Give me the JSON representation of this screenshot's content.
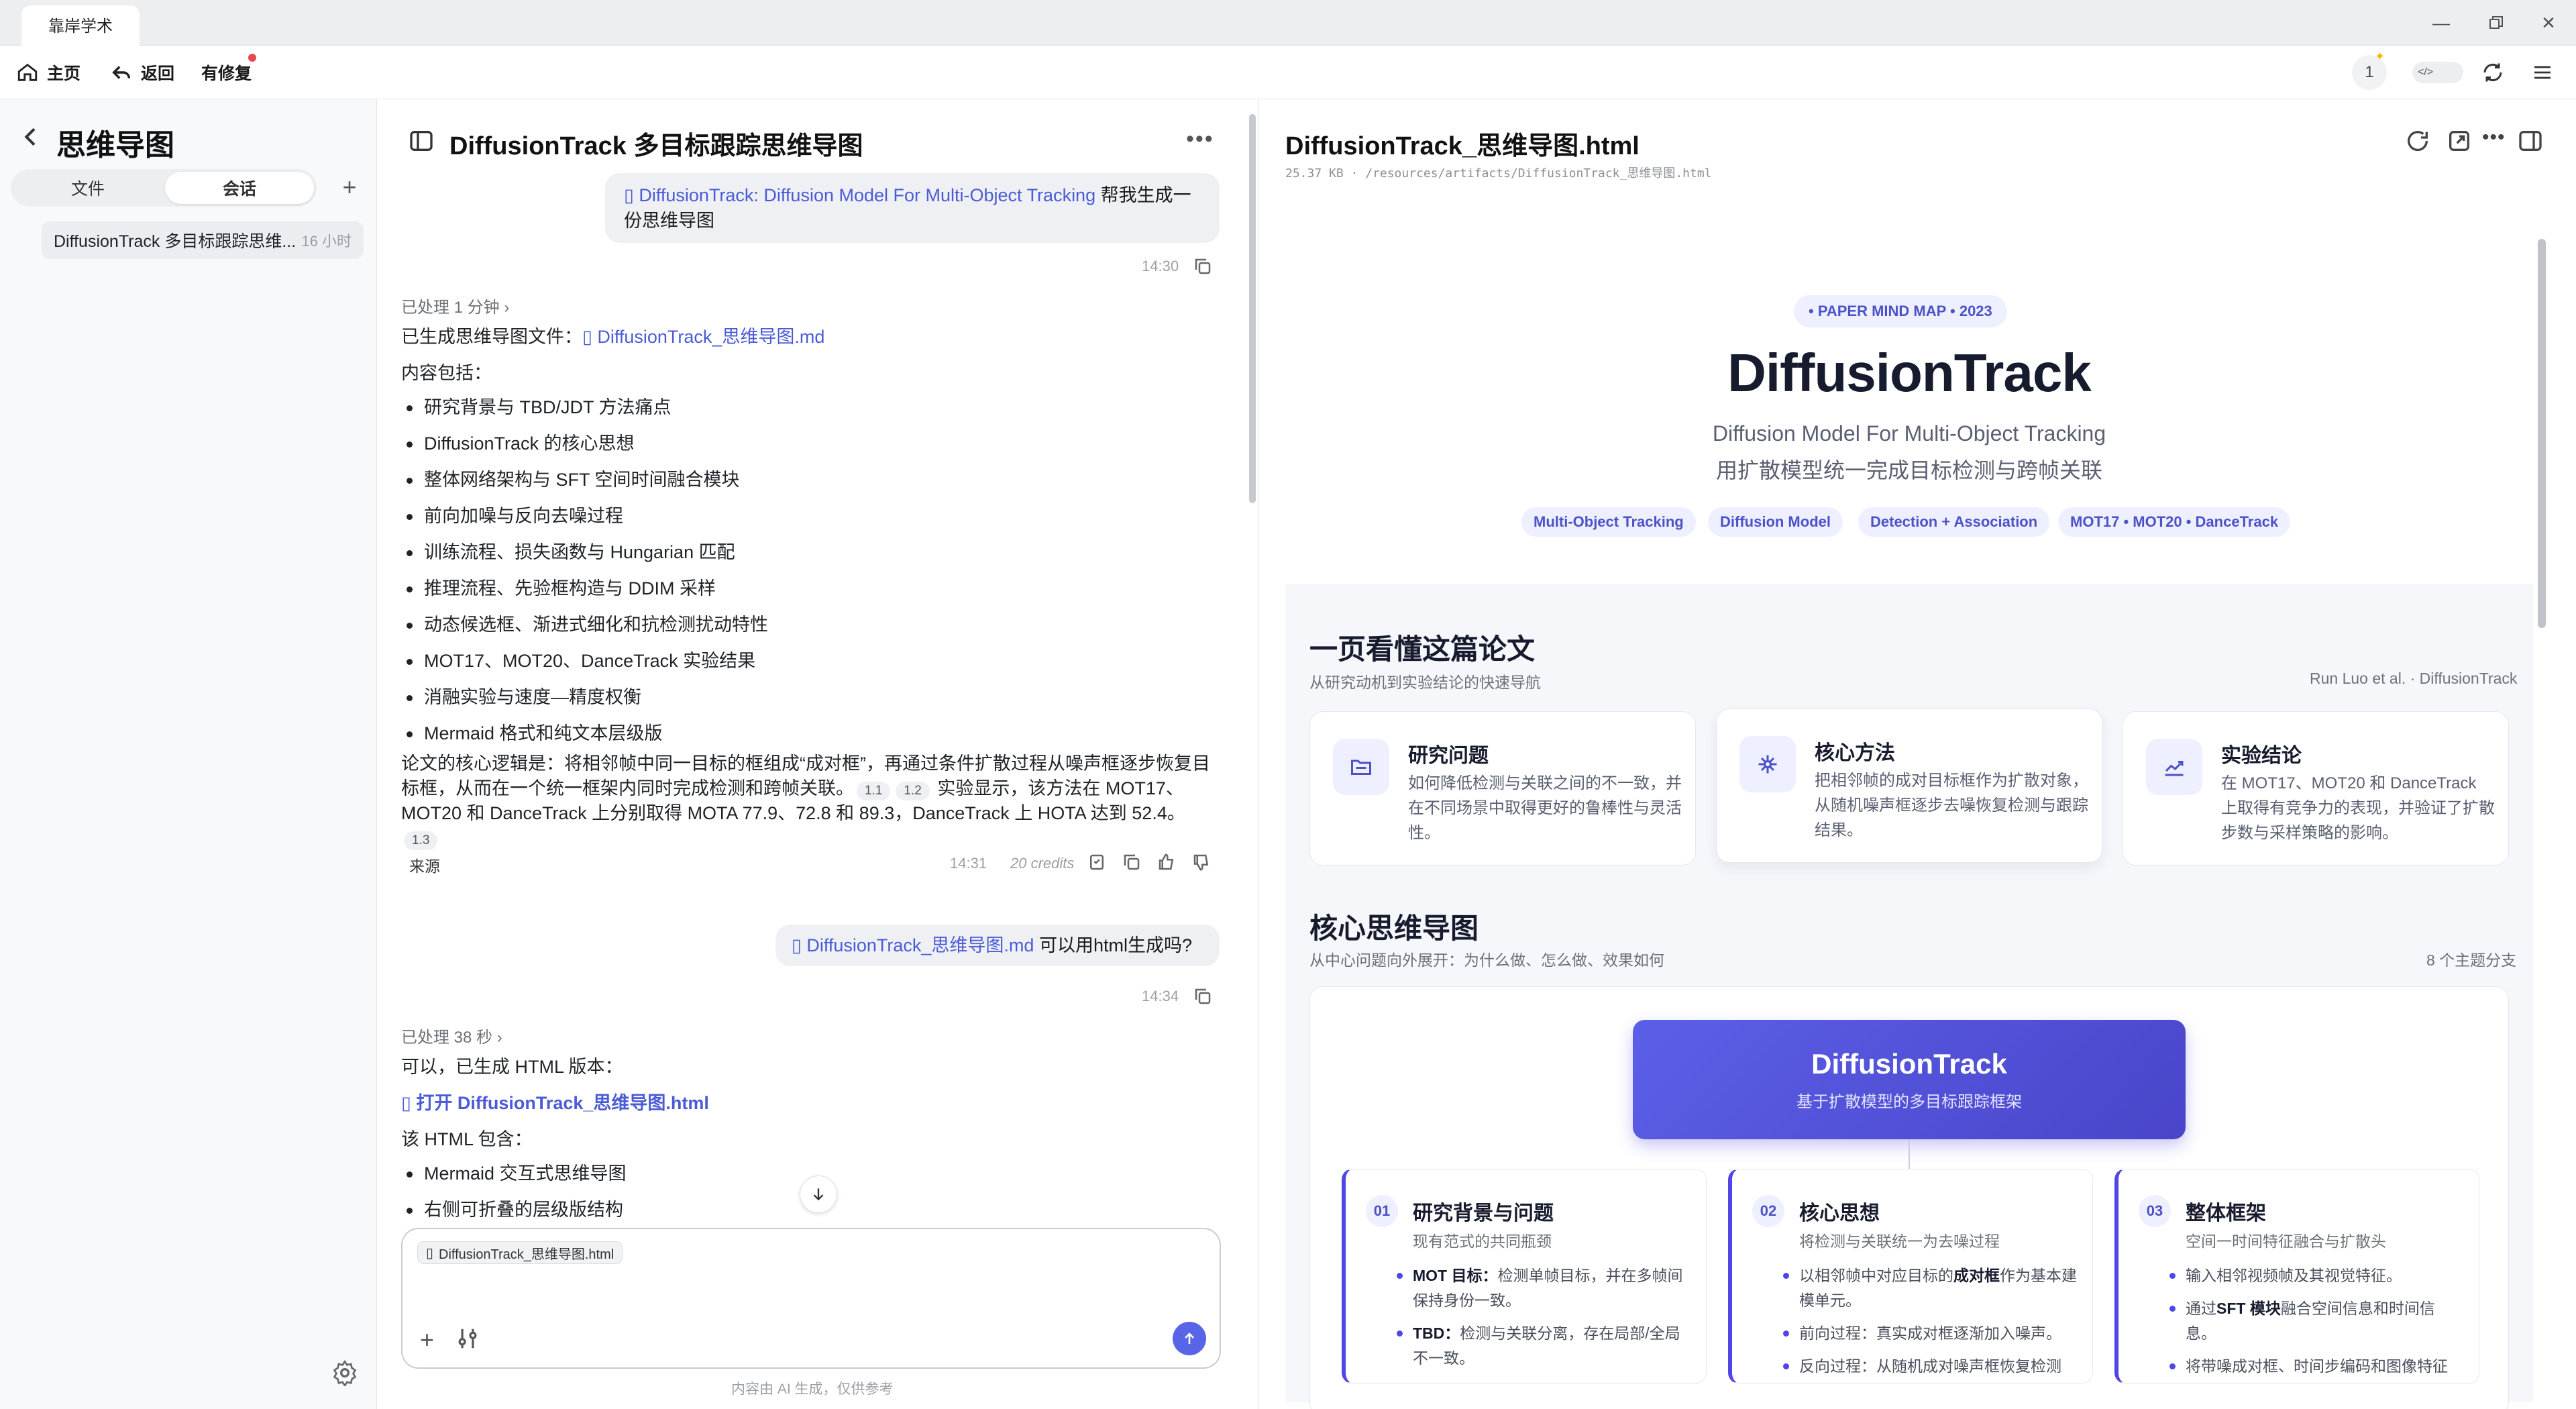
{
  "app": {
    "tab_title": "靠岸学术",
    "nav": {
      "home": "主页",
      "back": "返回",
      "update": "有修复"
    },
    "user_badge": "1"
  },
  "sidebar": {
    "title": "思维导图",
    "segments": [
      "文件",
      "会话"
    ],
    "items": [
      {
        "label": "DiffusionTrack 多目标跟踪思维...",
        "ago": "16 小时"
      }
    ]
  },
  "chat": {
    "title": "DiffusionTrack 多目标跟踪思维导图",
    "messages": {
      "user1": {
        "link": "DiffusionTrack: Diffusion Model For Multi-Object Tracking",
        "text": " 帮我生成一份思维导图",
        "time": "14:30"
      },
      "ai1": {
        "processed": "已处理 1 分钟",
        "file_prefix": "已生成思维导图文件：",
        "file_link": "DiffusionTrack_思维导图.md",
        "content_label": "内容包括：",
        "bullets": [
          "研究背景与 TBD/JDT 方法痛点",
          "DiffusionTrack 的核心思想",
          "整体网络架构与 SFT 空间时间融合模块",
          "前向加噪与反向去噪过程",
          "训练流程、损失函数与 Hungarian 匹配",
          "推理流程、先验框构造与 DDIM 采样",
          "动态候选框、渐进式细化和抗检测扰动特性",
          "MOT17、MOT20、DanceTrack 实验结果",
          "消融实验与速度—精度权衡",
          "Mermaid 格式和纯文本层级版"
        ],
        "summary_a": "论文的核心逻辑是：将相邻帧中同一目标的框组成“成对框”，再通过条件扩散过程从噪声框逐步恢复目标框，从而在一个统一框架内同时完成检测和跨帧关联。",
        "cite_1": "1.1",
        "cite_2": "1.2",
        "summary_b": " 实验显示，该方法在 MOT17、MOT20 和 DanceTrack 上分别取得 MOTA 77.9、72.8 和 89.3，DanceTrack 上 HOTA 达到 52.4。",
        "cite_3": "1.3",
        "source": "来源",
        "time": "14:31",
        "credits": "20 credits"
      },
      "user2": {
        "link": "DiffusionTrack_思维导图.md",
        "text": " 可以用html生成吗?",
        "time": "14:34"
      },
      "ai2": {
        "processed": "已处理 38 秒",
        "intro": "可以，已生成 HTML 版本：",
        "link": "打开 DiffusionTrack_思维导图.html",
        "includes": "该 HTML 包含：",
        "bullets": [
          "Mermaid 交互式思维导图",
          "右侧可折叠的层级版结构"
        ]
      }
    },
    "composer": {
      "attachment": "DiffusionTrack_思维导图.html"
    },
    "disclaimer": "内容由 AI 生成，仅供参考"
  },
  "preview": {
    "title": "DiffusionTrack_思维导图.html",
    "meta": "25.37 KB · /resources/artifacts/DiffusionTrack_思维导图.html",
    "hero": {
      "kicker": "• PAPER MIND MAP • 2023",
      "title": "DiffusionTrack",
      "subtitle_en": "Diffusion Model For Multi-Object Tracking",
      "subtitle_zh": "用扩散模型统一完成目标检测与跨帧关联",
      "tags": [
        "Multi-Object Tracking",
        "Diffusion Model",
        "Detection + Association",
        "MOT17 • MOT20 • DanceTrack"
      ]
    },
    "overview": {
      "title": "一页看懂这篇论文",
      "subtitle": "从研究动机到实验结论的快速导航",
      "byline": "Run Luo et al. · DiffusionTrack",
      "cards": [
        {
          "icon": "folder-icon",
          "title": "研究问题",
          "desc": "如何降低检测与关联之间的不一致，并在不同场景中取得更好的鲁棒性与灵活性。"
        },
        {
          "icon": "sparkle-icon",
          "title": "核心方法",
          "desc": "把相邻帧的成对目标框作为扩散对象，从随机噪声框逐步去噪恢复检测与跟踪结果。"
        },
        {
          "icon": "trend-chart-icon",
          "title": "实验结论",
          "desc": "在 MOT17、MOT20 和 DanceTrack 上取得有竞争力的表现，并验证了扩散步数与采样策略的影响。"
        }
      ]
    },
    "mindmap": {
      "title": "核心思维导图",
      "subtitle": "从中心问题向外展开：为什么做、怎么做、效果如何",
      "branch_count": "8 个主题分支",
      "root": {
        "title": "DiffusionTrack",
        "subtitle": "基于扩散模型的多目标跟踪框架"
      },
      "branches": [
        {
          "num": "01",
          "title": "研究背景与问题",
          "subtitle": "现有范式的共同瓶颈",
          "items": [
            {
              "bold": "MOT 目标：",
              "text": "检测单帧目标，并在多帧间保持身份一致。"
            },
            {
              "bold": "TBD：",
              "text": "检测与关联分离，存在局部/全局不一致。"
            }
          ]
        },
        {
          "num": "02",
          "title": "核心思想",
          "subtitle": "将检测与关联统一为去噪过程",
          "items": [
            {
              "pre": "以相邻帧中对应目标的",
              "bold": "成对框",
              "text": "作为基本建模单元。"
            },
            {
              "text": "前向过程：真实成对框逐渐加入噪声。"
            },
            {
              "text": "反向过程：从随机成对噪声框恢复检测"
            }
          ]
        },
        {
          "num": "03",
          "title": "整体框架",
          "subtitle": "空间一时间特征融合与扩散头",
          "items": [
            {
              "text": "输入相邻视频帧及其视觉特征。"
            },
            {
              "pre": "通过",
              "bold": "SFT 模块",
              "text": "融合空间信息和时间信息。"
            },
            {
              "text": "将带噪成对框、时间步编码和图像特征"
            }
          ]
        }
      ]
    }
  }
}
